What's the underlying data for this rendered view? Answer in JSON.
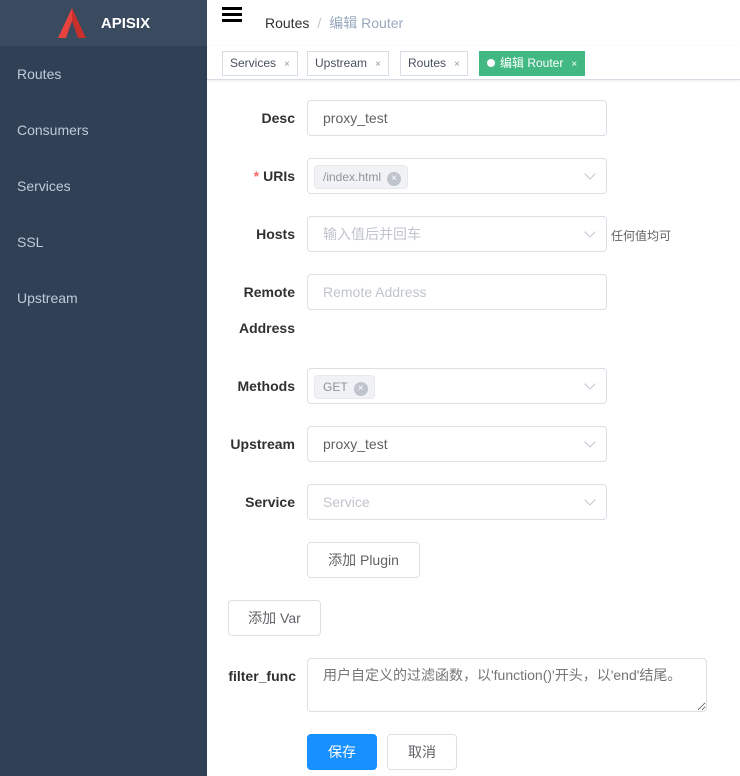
{
  "brand": {
    "name": "APISIX",
    "logo_color": "#e8423f"
  },
  "sidebar": {
    "items": [
      {
        "label": "Routes"
      },
      {
        "label": "Consumers"
      },
      {
        "label": "Services"
      },
      {
        "label": "SSL"
      },
      {
        "label": "Upstream"
      }
    ]
  },
  "breadcrumb": {
    "parent": "Routes",
    "separator": "/",
    "current": "编辑 Router"
  },
  "tags": [
    {
      "label": "Services"
    },
    {
      "label": "Upstream"
    },
    {
      "label": "Routes"
    },
    {
      "label": "编辑 Router",
      "active": true
    }
  ],
  "tag_close": "×",
  "form": {
    "desc": {
      "label": "Desc",
      "value": "proxy_test"
    },
    "uris": {
      "label": "URIs",
      "required_mark": "*",
      "chips": [
        "/index.html"
      ]
    },
    "hosts": {
      "label": "Hosts",
      "placeholder": "输入值后并回车",
      "hint": "任何值均可"
    },
    "remote": {
      "label1": "Remote",
      "label2": "Address",
      "placeholder": "Remote Address"
    },
    "methods": {
      "label": "Methods",
      "chips": [
        "GET"
      ]
    },
    "upstream": {
      "label": "Upstream",
      "value": "proxy_test"
    },
    "service": {
      "label": "Service",
      "placeholder": "Service"
    },
    "add_plugin": "添加 Plugin",
    "add_var": "添加 Var",
    "filter_func": {
      "label": "filter_func",
      "placeholder": "用户自定义的过滤函数，以'function()'开头，以'end'结尾。"
    },
    "save": "保存",
    "cancel": "取消"
  },
  "chip_close": "×"
}
